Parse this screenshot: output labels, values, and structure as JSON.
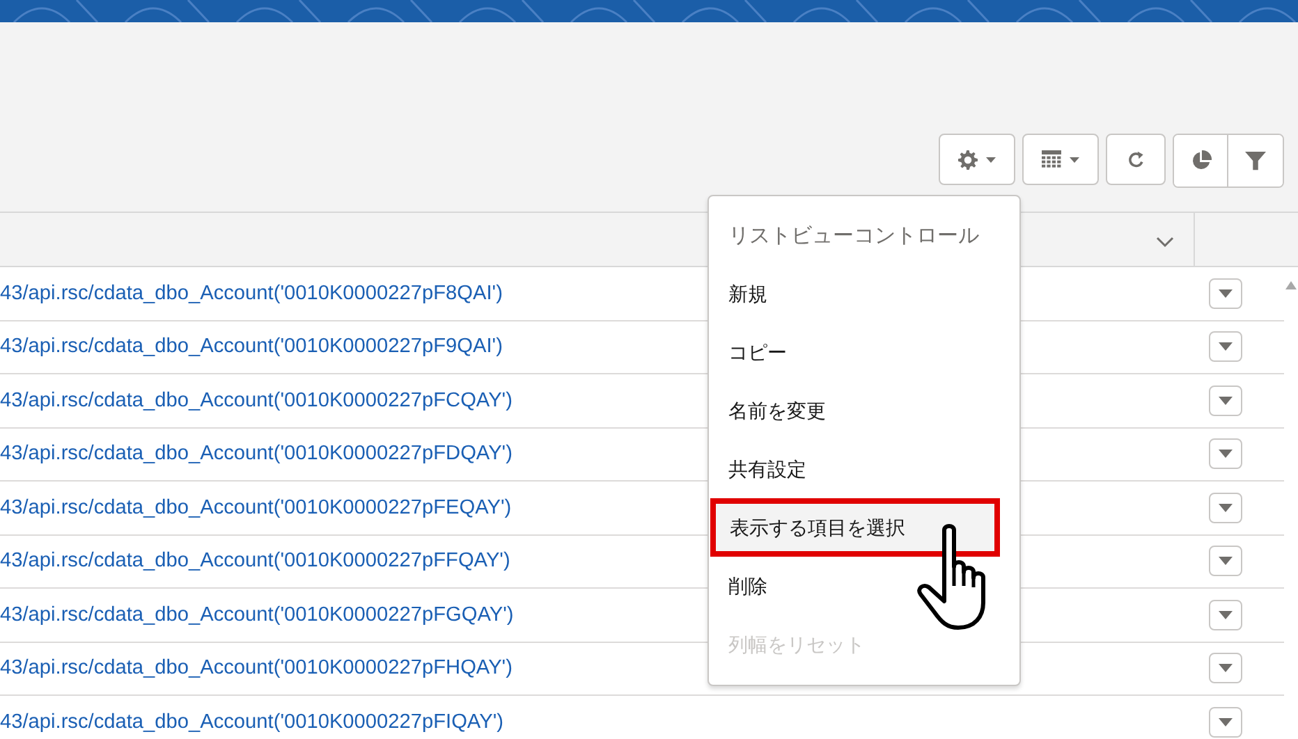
{
  "toolbar": {
    "buttons": [
      {
        "kind": "settings",
        "dropdown": true
      },
      {
        "kind": "table",
        "dropdown": true
      },
      {
        "kind": "refresh",
        "dropdown": false
      }
    ],
    "group": [
      {
        "kind": "chart"
      },
      {
        "kind": "filter"
      }
    ]
  },
  "table": {
    "rows": [
      {
        "link": "43/api.rsc/cdata_dbo_Account('0010K0000227pF8QAI')"
      },
      {
        "link": "43/api.rsc/cdata_dbo_Account('0010K0000227pF9QAI')"
      },
      {
        "link": "43/api.rsc/cdata_dbo_Account('0010K0000227pFCQAY')"
      },
      {
        "link": "43/api.rsc/cdata_dbo_Account('0010K0000227pFDQAY')"
      },
      {
        "link": "43/api.rsc/cdata_dbo_Account('0010K0000227pFEQAY')"
      },
      {
        "link": "43/api.rsc/cdata_dbo_Account('0010K0000227pFFQAY')"
      },
      {
        "link": "43/api.rsc/cdata_dbo_Account('0010K0000227pFGQAY')"
      },
      {
        "link": "43/api.rsc/cdata_dbo_Account('0010K0000227pFHQAY')"
      },
      {
        "link": "43/api.rsc/cdata_dbo_Account('0010K0000227pFIQAY')"
      }
    ]
  },
  "menu": {
    "title": "リストビューコントロール",
    "items": [
      {
        "label": "新規",
        "disabled": false,
        "selected": false
      },
      {
        "label": "コピー",
        "disabled": false,
        "selected": false
      },
      {
        "label": "名前を変更",
        "disabled": false,
        "selected": false
      },
      {
        "label": "共有設定",
        "disabled": false,
        "selected": false
      },
      {
        "label": "表示する項目を選択",
        "disabled": false,
        "selected": true
      },
      {
        "label": "削除",
        "disabled": false,
        "selected": false
      },
      {
        "label": "列幅をリセット",
        "disabled": true,
        "selected": false
      }
    ]
  }
}
